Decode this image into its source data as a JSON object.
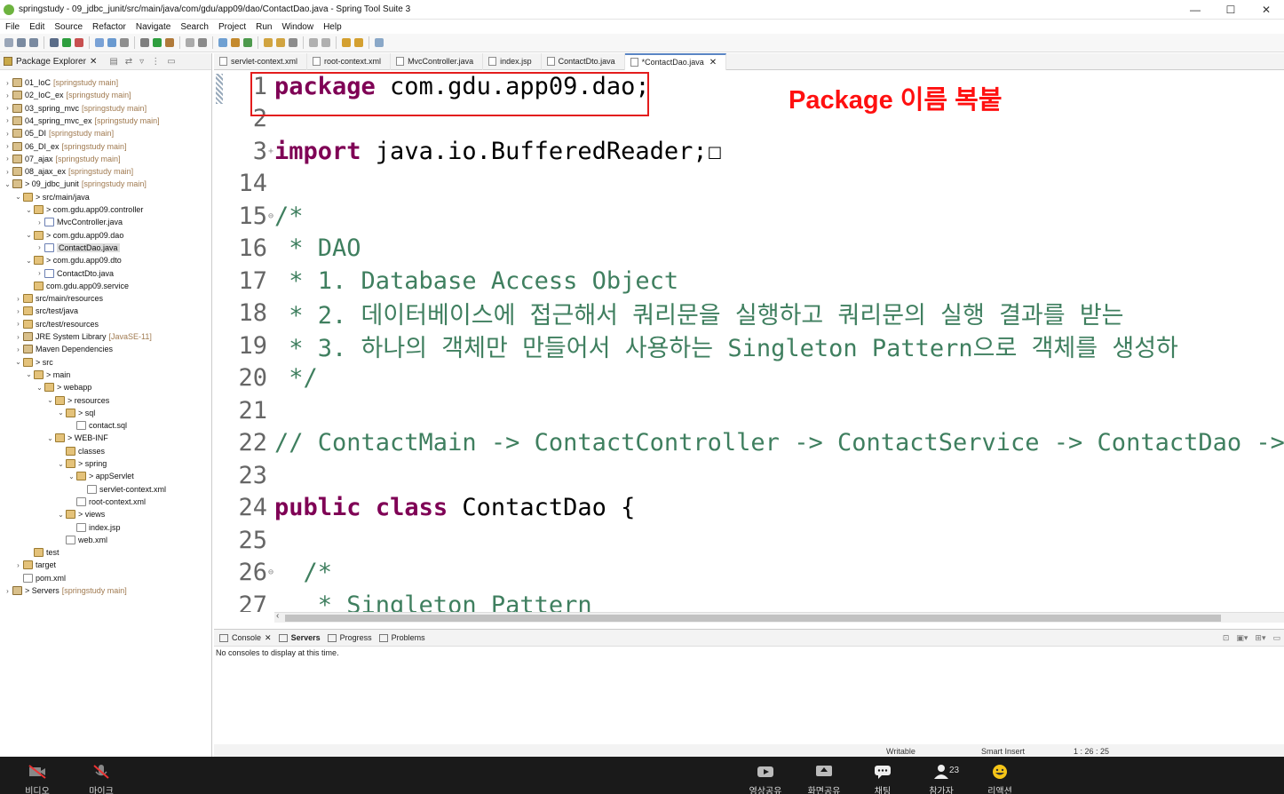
{
  "window": {
    "title": "springstudy - 09_jdbc_junit/src/main/java/com/gdu/app09/dao/ContactDao.java - Spring Tool Suite 3",
    "controls": [
      "—",
      "☐",
      "✕"
    ]
  },
  "menu": [
    "File",
    "Edit",
    "Source",
    "Refactor",
    "Navigate",
    "Search",
    "Project",
    "Run",
    "Window",
    "Help"
  ],
  "explorer": {
    "title": "Package Explorer",
    "tree": [
      {
        "label": "01_IoC",
        "dec": "[springstudy main]"
      },
      {
        "label": "02_IoC_ex",
        "dec": "[springstudy main]"
      },
      {
        "label": "03_spring_mvc",
        "dec": "[springstudy main]"
      },
      {
        "label": "04_spring_mvc_ex",
        "dec": "[springstudy main]"
      },
      {
        "label": "05_DI",
        "dec": "[springstudy main]"
      },
      {
        "label": "06_DI_ex",
        "dec": "[springstudy main]"
      },
      {
        "label": "07_ajax",
        "dec": "[springstudy main]"
      },
      {
        "label": "08_ajax_ex",
        "dec": "[springstudy main]"
      },
      {
        "label": "> 09_jdbc_junit",
        "dec": "[springstudy main]"
      },
      {
        "label": "> src/main/java",
        "dec": ""
      },
      {
        "label": "> com.gdu.app09.controller",
        "dec": ""
      },
      {
        "label": "MvcController.java",
        "dec": ""
      },
      {
        "label": "> com.gdu.app09.dao",
        "dec": ""
      },
      {
        "label": "ContactDao.java",
        "dec": ""
      },
      {
        "label": "> com.gdu.app09.dto",
        "dec": ""
      },
      {
        "label": "ContactDto.java",
        "dec": ""
      },
      {
        "label": "com.gdu.app09.service",
        "dec": ""
      },
      {
        "label": "src/main/resources",
        "dec": ""
      },
      {
        "label": "src/test/java",
        "dec": ""
      },
      {
        "label": "src/test/resources",
        "dec": ""
      },
      {
        "label": "JRE System Library",
        "dec": "[JavaSE-11]"
      },
      {
        "label": "Maven Dependencies",
        "dec": ""
      },
      {
        "label": "> src",
        "dec": ""
      },
      {
        "label": "> main",
        "dec": ""
      },
      {
        "label": "> webapp",
        "dec": ""
      },
      {
        "label": "> resources",
        "dec": ""
      },
      {
        "label": "> sql",
        "dec": ""
      },
      {
        "label": "contact.sql",
        "dec": ""
      },
      {
        "label": "> WEB-INF",
        "dec": ""
      },
      {
        "label": "classes",
        "dec": ""
      },
      {
        "label": "> spring",
        "dec": ""
      },
      {
        "label": "> appServlet",
        "dec": ""
      },
      {
        "label": "servlet-context.xml",
        "dec": ""
      },
      {
        "label": "root-context.xml",
        "dec": ""
      },
      {
        "label": "> views",
        "dec": ""
      },
      {
        "label": "index.jsp",
        "dec": ""
      },
      {
        "label": "web.xml",
        "dec": ""
      },
      {
        "label": "test",
        "dec": ""
      },
      {
        "label": "target",
        "dec": ""
      },
      {
        "label": "pom.xml",
        "dec": ""
      },
      {
        "label": "> Servers",
        "dec": "[springstudy main]"
      }
    ]
  },
  "tabs": [
    "servlet-context.xml",
    "root-context.xml",
    "MvcController.java",
    "index.jsp",
    "ContactDto.java",
    "*ContactDao.java"
  ],
  "code": [
    {
      "ln": "1",
      "fold": "",
      "parts": [
        {
          "t": "package",
          "c": "kw"
        },
        {
          "t": " com.gdu.app09.dao;",
          "c": ""
        }
      ]
    },
    {
      "ln": "2",
      "fold": "",
      "parts": []
    },
    {
      "ln": "3",
      "fold": "+",
      "parts": [
        {
          "t": "import",
          "c": "kw"
        },
        {
          "t": " java.io.BufferedReader;",
          "c": ""
        },
        {
          "t": "☐",
          "c": ""
        }
      ]
    },
    {
      "ln": "14",
      "fold": "",
      "parts": []
    },
    {
      "ln": "15",
      "fold": "⊖",
      "parts": [
        {
          "t": "/*",
          "c": "cm"
        }
      ]
    },
    {
      "ln": "16",
      "fold": "",
      "parts": [
        {
          "t": " * DAO",
          "c": "cm"
        }
      ]
    },
    {
      "ln": "17",
      "fold": "",
      "parts": [
        {
          "t": " * 1. Database Access Object",
          "c": "cm"
        }
      ]
    },
    {
      "ln": "18",
      "fold": "",
      "parts": [
        {
          "t": " * 2. 데이터베이스에 접근해서 쿼리문을 실행하고 쿼리문의 실행 결과를 받는",
          "c": "cm"
        }
      ]
    },
    {
      "ln": "19",
      "fold": "",
      "parts": [
        {
          "t": " * 3. 하나의 객체만 만들어서 사용하는 Singleton Pattern으로 객체를 생성하",
          "c": "cm"
        }
      ]
    },
    {
      "ln": "20",
      "fold": "",
      "parts": [
        {
          "t": " */",
          "c": "cm"
        }
      ]
    },
    {
      "ln": "21",
      "fold": "",
      "parts": []
    },
    {
      "ln": "22",
      "fold": "",
      "parts": [
        {
          "t": "// ContactMain -> ContactController -> ContactService -> ContactDao -> DB",
          "c": "cm"
        }
      ]
    },
    {
      "ln": "23",
      "fold": "",
      "parts": []
    },
    {
      "ln": "24",
      "fold": "",
      "parts": [
        {
          "t": "public",
          "c": "kw"
        },
        {
          "t": " ",
          "c": ""
        },
        {
          "t": "class",
          "c": "kw"
        },
        {
          "t": " ContactDao {",
          "c": ""
        }
      ]
    },
    {
      "ln": "25",
      "fold": "",
      "parts": []
    },
    {
      "ln": "26",
      "fold": "⊖",
      "parts": [
        {
          "t": "  /*",
          "c": "cm"
        }
      ]
    },
    {
      "ln": "27",
      "fold": "",
      "parts": [
        {
          "t": "   * Singleton Pattern",
          "c": "cm"
        }
      ]
    }
  ],
  "annotation": "Package 이름 복붙",
  "bottom": {
    "tabs": [
      "Console",
      "Servers",
      "Progress",
      "Problems"
    ],
    "message": "No consoles to display at this time."
  },
  "status": {
    "writable": "Writable",
    "insert": "Smart Insert",
    "position": "1 : 26 : 25"
  },
  "zoom": {
    "participants_count": "23",
    "buttons": [
      "비디오",
      "마이크",
      "영상공유",
      "화면공유",
      "채팅",
      "참가자",
      "리액션"
    ]
  },
  "colors": {
    "keyword": "#7f0055",
    "comment": "#3f7f5f",
    "annotation": "#ff1010",
    "highlight_box": "#e31c1c"
  }
}
